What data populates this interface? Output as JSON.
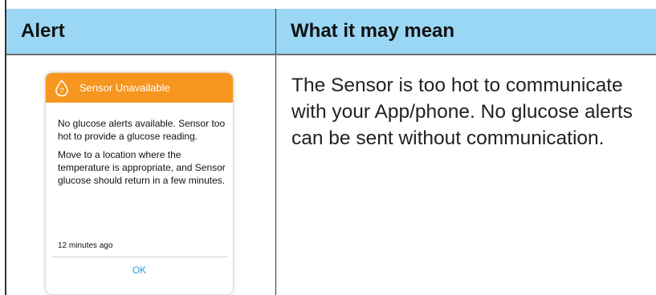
{
  "table": {
    "headers": [
      "Alert",
      "What it may mean"
    ],
    "row": {
      "meaning": "The Sensor is too hot to communicate with your App/phone. No glucose alerts can be sent without communication."
    }
  },
  "dialog": {
    "title": "Sensor Unavailable",
    "icon": "sensor-drop-question-icon",
    "paragraphs": [
      "No glucose alerts available. Sensor too hot to provide a glucose reading.",
      "Move to a location where the temperature is appropriate, and Sensor glucose should return in a few minutes."
    ],
    "timestamp": "12 minutes ago",
    "ok_label": "OK"
  },
  "colors": {
    "header_bg": "#9ad7f4",
    "alert_orange": "#f6961e",
    "ok_blue": "#2f9ad8"
  }
}
